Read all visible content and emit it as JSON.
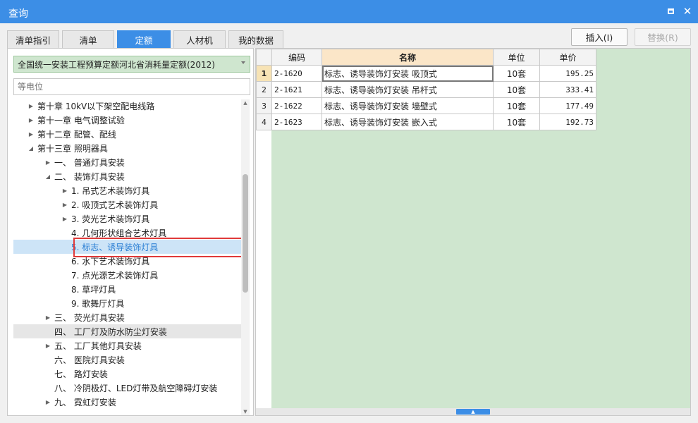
{
  "window": {
    "title": "查询"
  },
  "tabs": [
    {
      "label": "清单指引",
      "active": false
    },
    {
      "label": "清单",
      "active": false
    },
    {
      "label": "定额",
      "active": true
    },
    {
      "label": "人材机",
      "active": false
    },
    {
      "label": "我的数据",
      "active": false
    }
  ],
  "actions": {
    "insert": "插入(I)",
    "replace": "替换(R)"
  },
  "library": {
    "selected": "全国统一安装工程预算定额河北省消耗量定额(2012)"
  },
  "search": {
    "placeholder": "等电位"
  },
  "tree": [
    {
      "label": "第十章 10kV以下架空配电线路",
      "arrow": "collapsed"
    },
    {
      "label": "第十一章 电气调整试验",
      "arrow": "collapsed"
    },
    {
      "label": "第十二章 配管、配线",
      "arrow": "collapsed"
    },
    {
      "label": "第十三章 照明器具",
      "arrow": "expanded"
    },
    {
      "label": "一、 普通灯具安装",
      "arrow": "collapsed"
    },
    {
      "label": "二、 装饰灯具安装",
      "arrow": "expanded"
    },
    {
      "label": "1. 吊式艺术装饰灯具",
      "arrow": "collapsed"
    },
    {
      "label": "2. 吸顶式艺术装饰灯具",
      "arrow": "collapsed"
    },
    {
      "label": "3. 荧光艺术装饰灯具",
      "arrow": "collapsed"
    },
    {
      "label": "4. 几何形状组合艺术灯具",
      "arrow": "none"
    },
    {
      "label": "5. 标志、诱导装饰灯具",
      "arrow": "none",
      "state": "selected"
    },
    {
      "label": "6. 水下艺术装饰灯具",
      "arrow": "none"
    },
    {
      "label": "7. 点光源艺术装饰灯具",
      "arrow": "none"
    },
    {
      "label": "8. 草坪灯具",
      "arrow": "none"
    },
    {
      "label": "9. 歌舞厅灯具",
      "arrow": "none"
    },
    {
      "label": "三、 荧光灯具安装",
      "arrow": "collapsed"
    },
    {
      "label": "四、 工厂灯及防水防尘灯安装",
      "arrow": "none",
      "state": "hover"
    },
    {
      "label": "五、 工厂其他灯具安装",
      "arrow": "collapsed"
    },
    {
      "label": "六、 医院灯具安装",
      "arrow": "none"
    },
    {
      "label": "七、 路灯安装",
      "arrow": "none"
    },
    {
      "label": "八、 冷阴极灯、LED灯带及航空障碍灯安装",
      "arrow": "none"
    },
    {
      "label": "九、 霓虹灯安装",
      "arrow": "collapsed"
    }
  ],
  "grid": {
    "headers": {
      "code": "编码",
      "name": "名称",
      "unit": "单位",
      "price": "单价"
    },
    "rows": [
      {
        "n": "1",
        "code": "2-1620",
        "name": "标志、诱导装饰灯安装 吸顶式",
        "unit": "10套",
        "price": "195.25"
      },
      {
        "n": "2",
        "code": "2-1621",
        "name": "标志、诱导装饰灯安装 吊杆式",
        "unit": "10套",
        "price": "333.41"
      },
      {
        "n": "3",
        "code": "2-1622",
        "name": "标志、诱导装饰灯安装 墙壁式",
        "unit": "10套",
        "price": "177.49"
      },
      {
        "n": "4",
        "code": "2-1623",
        "name": "标志、诱导装饰灯安装 嵌入式",
        "unit": "10套",
        "price": "192.73"
      }
    ]
  },
  "colors": {
    "accent": "#3c8ee6",
    "grid_bg": "#cfe6cf",
    "highlight_box": "#e03a3a"
  }
}
